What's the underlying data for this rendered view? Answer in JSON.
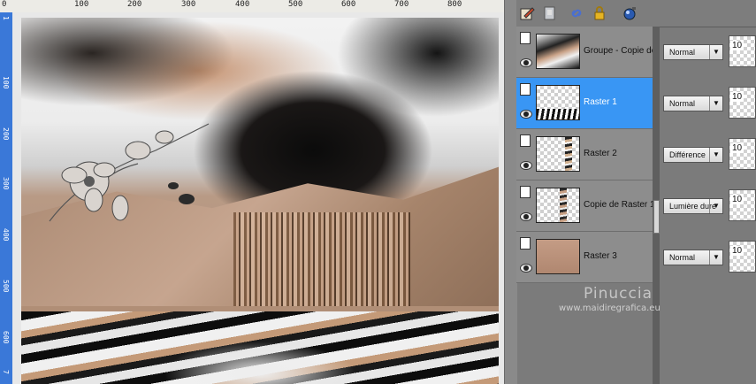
{
  "ruler": {
    "top_labels": [
      "0",
      "100",
      "200",
      "300",
      "400",
      "500",
      "600",
      "700",
      "800"
    ],
    "left_labels": [
      "1",
      "100",
      "200",
      "300",
      "400",
      "500",
      "600",
      "7"
    ]
  },
  "toolbar": {
    "icons": [
      "edit-layer-icon",
      "duplicate-layer-icon",
      "link-icon",
      "lock-icon",
      "mask-icon"
    ]
  },
  "layers": [
    {
      "name": "Groupe - Copie de",
      "blend_mode": "Normal",
      "opacity": "10",
      "selected": false
    },
    {
      "name": "Raster 1",
      "blend_mode": "Normal",
      "opacity": "10",
      "selected": true
    },
    {
      "name": "Raster 2",
      "blend_mode": "Différence",
      "opacity": "10",
      "selected": false
    },
    {
      "name": "Copie de Raster 1",
      "blend_mode": "Lumière dure",
      "opacity": "10",
      "selected": false
    },
    {
      "name": "Raster 3",
      "blend_mode": "Normal",
      "opacity": "10",
      "selected": false
    }
  ],
  "watermark": {
    "name": "Pinuccia",
    "url": "www.maidiregrafica.eu"
  },
  "colors": {
    "selection": "#3996f4",
    "panel": "#8d8d8d",
    "ruler_left": "#3a78d8"
  }
}
